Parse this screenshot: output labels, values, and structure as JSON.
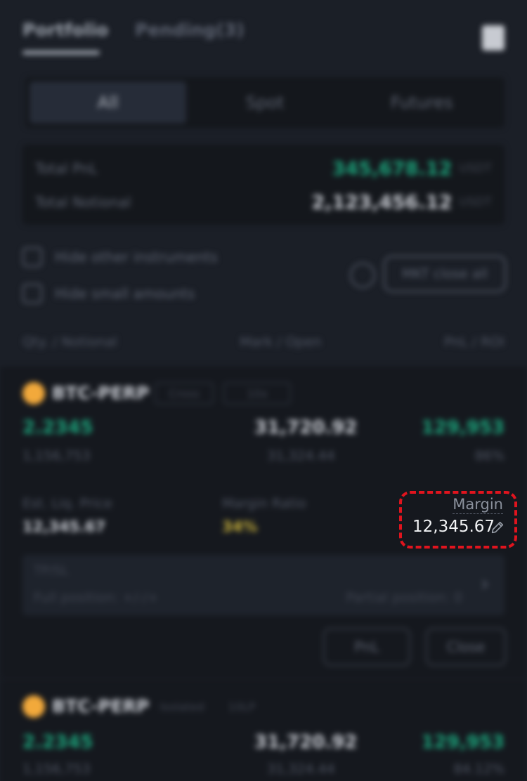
{
  "tabs": [
    {
      "label": "Portfolio",
      "active": true
    },
    {
      "label": "Pending(3)",
      "active": false
    }
  ],
  "segments": [
    {
      "label": "All",
      "active": true
    },
    {
      "label": "Spot",
      "active": false
    },
    {
      "label": "Futures",
      "active": false
    }
  ],
  "summary": {
    "pnl_label": "Total PnL",
    "pnl_value": "345,678.12",
    "notional_label": "Total Notional",
    "notional_value": "2,123,456.12",
    "unit": "USDT"
  },
  "filters": {
    "hide_other": "Hide other instruments",
    "hide_small": "Hide small amounts",
    "close_all": "MKT close all"
  },
  "columns": {
    "qty": "Qty. / Notional",
    "mark": "Mark / Open",
    "pnl": "PnL / ROI"
  },
  "positions": [
    {
      "pair": "BTC-PERP",
      "mode": "Cross",
      "leverage": "10x",
      "qty": "2.2345",
      "notional": "1,156,753",
      "mark": "31,720.92",
      "open": "31,324.44",
      "pnl": "129,953",
      "roi": "86%",
      "liq_label": "Est. Liq. Price",
      "liq_value": "12,345.67",
      "ratio_label": "Margin Ratio",
      "ratio_value": "34%",
      "margin_label": "Margin",
      "margin_value": "12,345.67",
      "tpsl_title": "TP/SL",
      "tpsl_full": "Full position: +/-/+",
      "tpsl_partial": "Partial position: 0",
      "pnl_button": "PnL",
      "close_button": "Close"
    },
    {
      "pair": "BTC-PERP",
      "mode": "Isolated",
      "leverage": "10LP",
      "qty": "2.2345",
      "notional": "1,156,753",
      "mark": "31,720.92",
      "open": "31,324.44",
      "pnl": "129,953",
      "roi": "84.12%"
    }
  ],
  "colors": {
    "background": "#1b1f27",
    "green": "#1ba27a",
    "yellow": "#c9b23b",
    "highlight": "#e0141e"
  }
}
